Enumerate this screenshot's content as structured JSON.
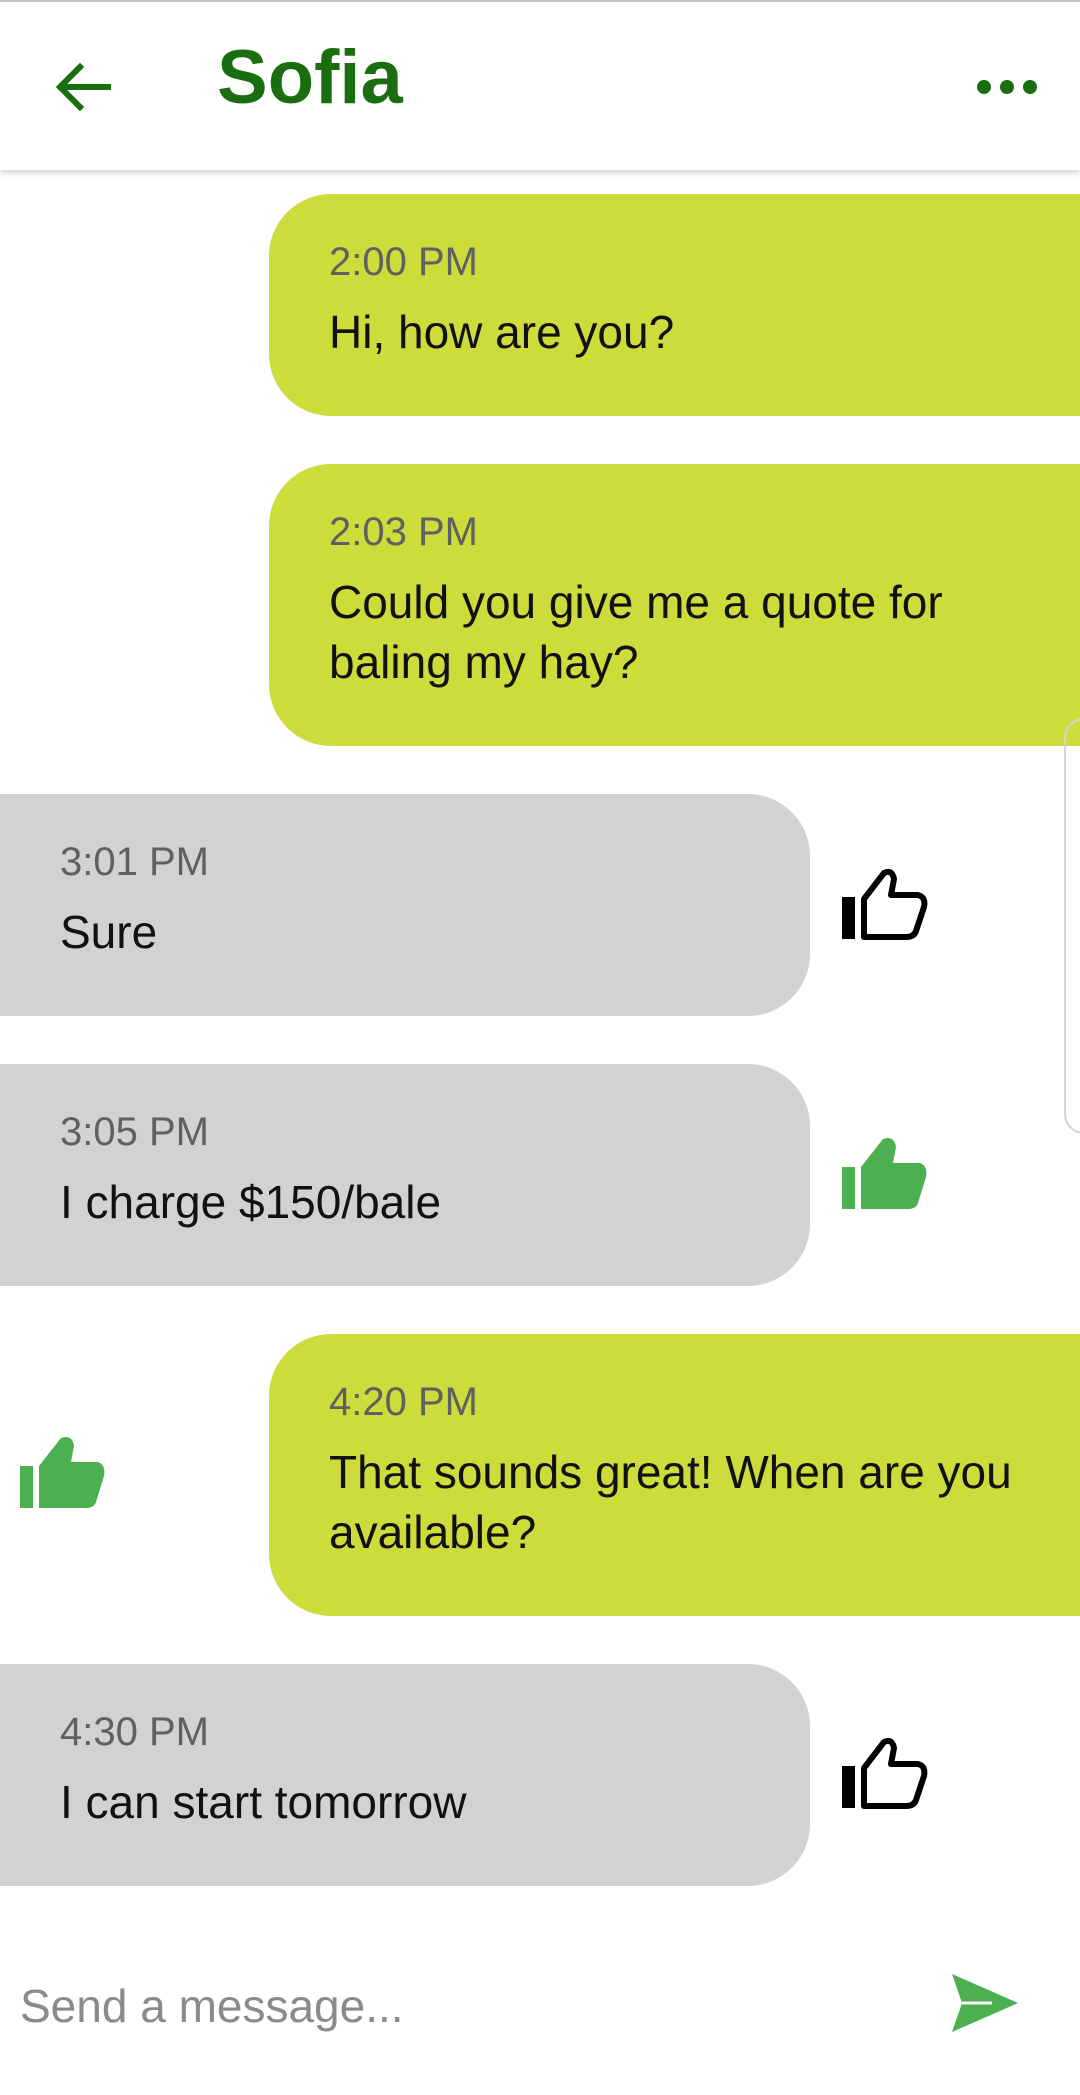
{
  "header": {
    "title": "Sofia",
    "back_icon": "arrow-left-icon",
    "more_icon": "more-horizontal-icon",
    "accent_color": "#1b6e0f"
  },
  "messages": [
    {
      "direction": "sent",
      "time": "2:00 PM",
      "text": "Hi, how are you?"
    },
    {
      "direction": "sent",
      "time": "2:03 PM",
      "text": "Could you give me a quote for baling my hay?"
    },
    {
      "direction": "received",
      "time": "3:01 PM",
      "text": "Sure",
      "like": "outline"
    },
    {
      "direction": "received",
      "time": "3:05 PM",
      "text": "I charge $150/bale",
      "like": "filled"
    },
    {
      "direction": "sent",
      "time": "4:20 PM",
      "text": "That sounds great! When are you available?",
      "like": "filled"
    },
    {
      "direction": "received",
      "time": "4:30 PM",
      "text": "I can start tomorrow",
      "like": "outline"
    }
  ],
  "composer": {
    "placeholder": "Send a message...",
    "send_icon": "send-icon"
  },
  "colors": {
    "sent_bubble": "#cddc3a",
    "received_bubble": "#d2d2d2",
    "like_active": "#4caf50",
    "like_inactive": "#000000"
  }
}
